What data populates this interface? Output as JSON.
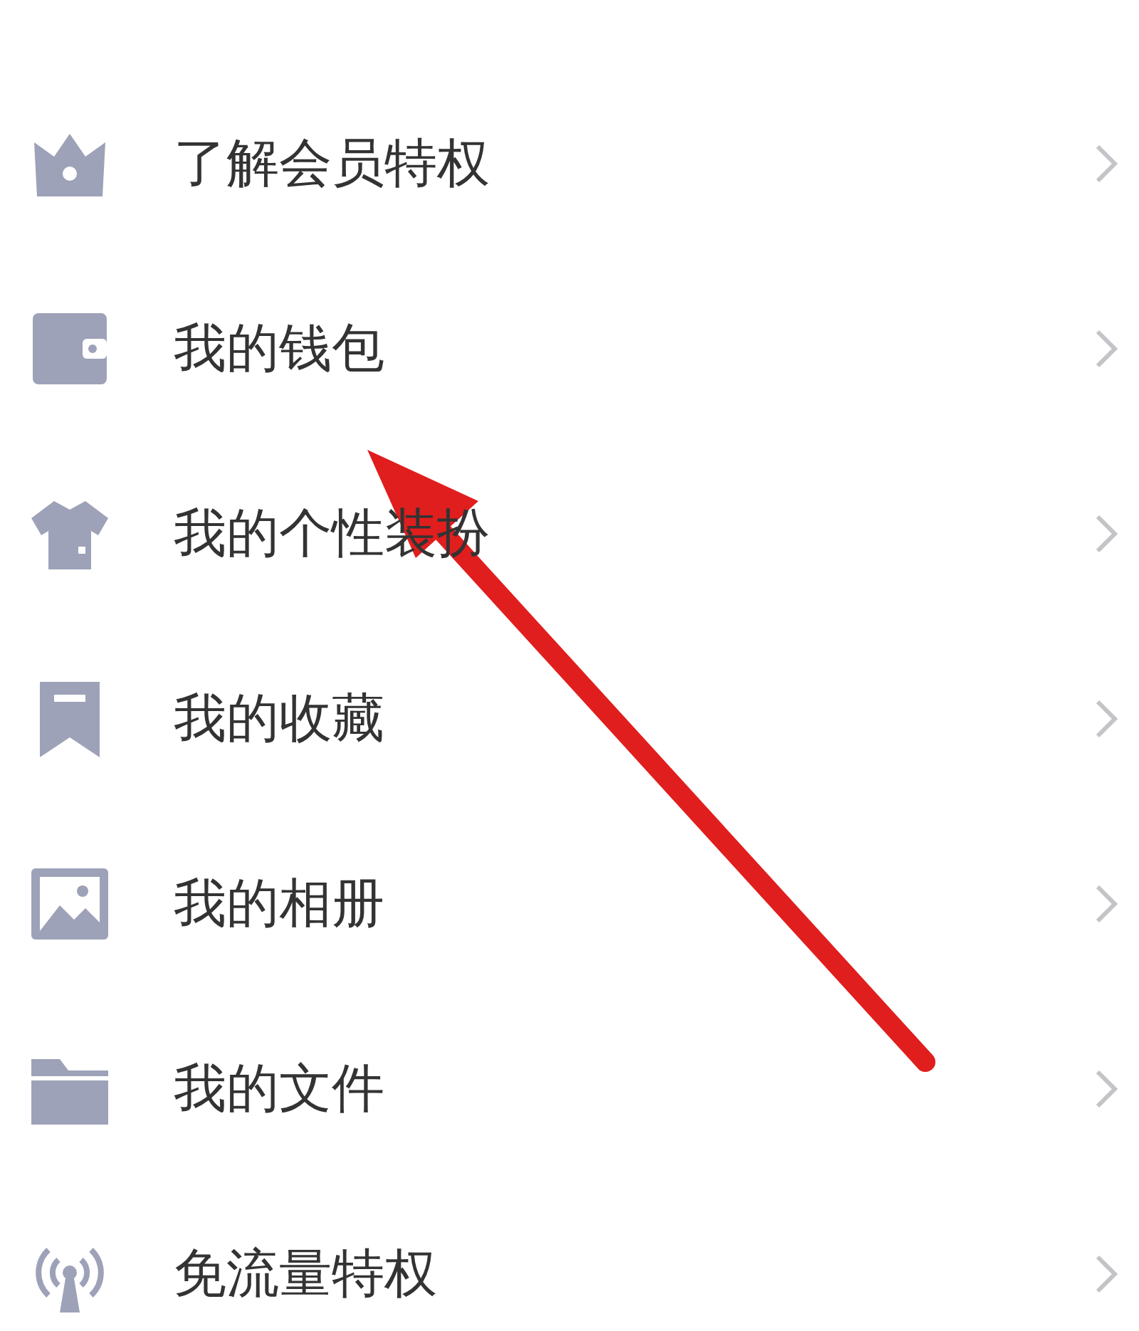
{
  "menu": {
    "items": [
      {
        "label": "了解会员特权"
      },
      {
        "label": "我的钱包"
      },
      {
        "label": "我的个性装扮"
      },
      {
        "label": "我的收藏"
      },
      {
        "label": "我的相册"
      },
      {
        "label": "我的文件"
      },
      {
        "label": "免流量特权"
      }
    ]
  }
}
